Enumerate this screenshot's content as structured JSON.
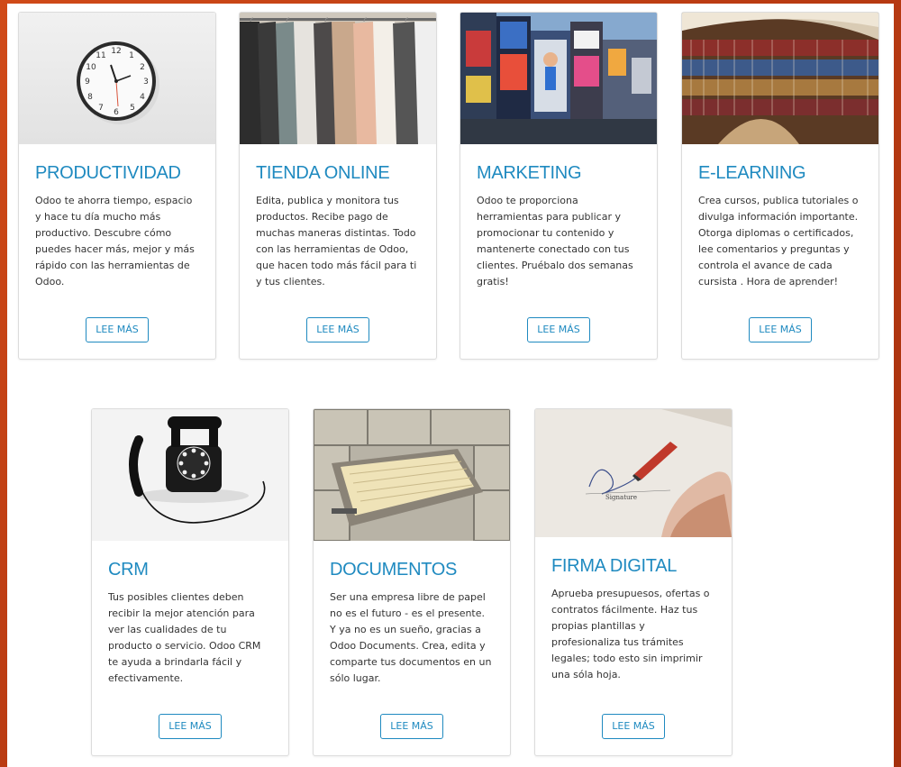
{
  "cards": [
    {
      "title": "PRODUCTIVIDAD",
      "description": "Odoo te ahorra tiempo, espacio y hace tu día mucho más productivo.  Descubre cómo puedes hacer más, mejor y más rápido con las herramientas de Odoo.",
      "button": "LEE MÁS",
      "image": "wall-clock-photo"
    },
    {
      "title": "TIENDA ONLINE",
      "description": "Edita, publica y monitora tus productos. Recibe pago de muchas maneras distintas. Todo con las herramientas de Odoo, que hacen todo más fácil para ti y tus clientes.",
      "button": "LEE MÁS",
      "image": "clothing-rack-photo"
    },
    {
      "title": "MARKETING",
      "description": "Odoo te proporciona herramientas para publicar y promocionar tu contenido y mantenerte conectado con tus clientes. Pruébalo dos semanas gratis!",
      "button": "LEE MÁS",
      "image": "city-billboards-photo"
    },
    {
      "title": "E-LEARNING",
      "description": "Crea cursos, publica tutoriales o divulga información importante. Otorga diplomas o certificados, lee comentarios y preguntas y controla el avance de cada cursista . Hora de aprender!",
      "button": "LEE MÁS",
      "image": "library-shelves-photo"
    },
    {
      "title": "CRM",
      "description": "Tus posibles clientes deben recibir la mejor atención para ver las cualidades de tu producto o servicio. Odoo CRM te ayuda a brindarla fácil y efectivamente.",
      "button": "LEE MÁS",
      "image": "rotary-phone-photo"
    },
    {
      "title": "DOCUMENTOS",
      "description": "Ser una empresa libre de papel no es el futuro - es el presente. Y ya no es un sueño, gracias a Odoo Documents. Crea, edita y comparte tus documentos en un sólo lugar.",
      "button": "LEE MÁS",
      "image": "file-cabinet-photo"
    },
    {
      "title": "FIRMA DIGITAL",
      "description": "Aprueba presupuesos, ofertas o contratos fácilmente. Haz tus propias plantillas y profesionaliza tus trámites legales; todo esto sin imprimir una sóla hoja.",
      "button": "LEE MÁS",
      "image": "signature-pen-photo"
    }
  ],
  "clock_numbers": [
    "12",
    "1",
    "2",
    "3",
    "4",
    "5",
    "6",
    "7",
    "8",
    "9",
    "10",
    "11"
  ],
  "signature_text": "Signature",
  "colors": {
    "accent": "#1f8ac0",
    "frame": "#c8441a"
  }
}
